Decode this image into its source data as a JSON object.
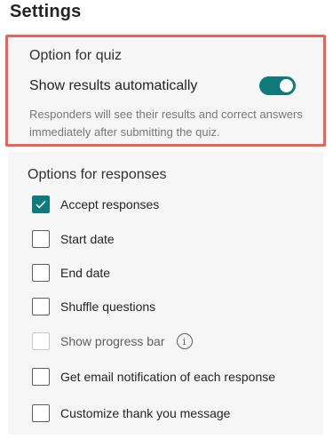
{
  "header": {
    "title": "Settings"
  },
  "quiz": {
    "heading": "Option for quiz",
    "toggle_label": "Show results automatically",
    "toggle_on": true,
    "help_text": "Responders will see their results and correct answers immediately after submitting the quiz."
  },
  "responses": {
    "heading": "Options for responses",
    "items": [
      {
        "label": "Accept responses",
        "checked": true,
        "disabled": false
      },
      {
        "label": "Start date",
        "checked": false,
        "disabled": false
      },
      {
        "label": "End date",
        "checked": false,
        "disabled": false
      },
      {
        "label": "Shuffle questions",
        "checked": false,
        "disabled": false
      },
      {
        "label": "Show progress bar",
        "checked": false,
        "disabled": true,
        "info_icon": "info-icon"
      },
      {
        "label": "Get email notification of each response",
        "checked": false,
        "disabled": false
      },
      {
        "label": "Customize thank you message",
        "checked": false,
        "disabled": false
      }
    ]
  },
  "colors": {
    "accent": "#0f7a7c",
    "highlight_border": "#e8645a",
    "panel_bg": "#f6f6f6",
    "muted_text": "#797775"
  }
}
